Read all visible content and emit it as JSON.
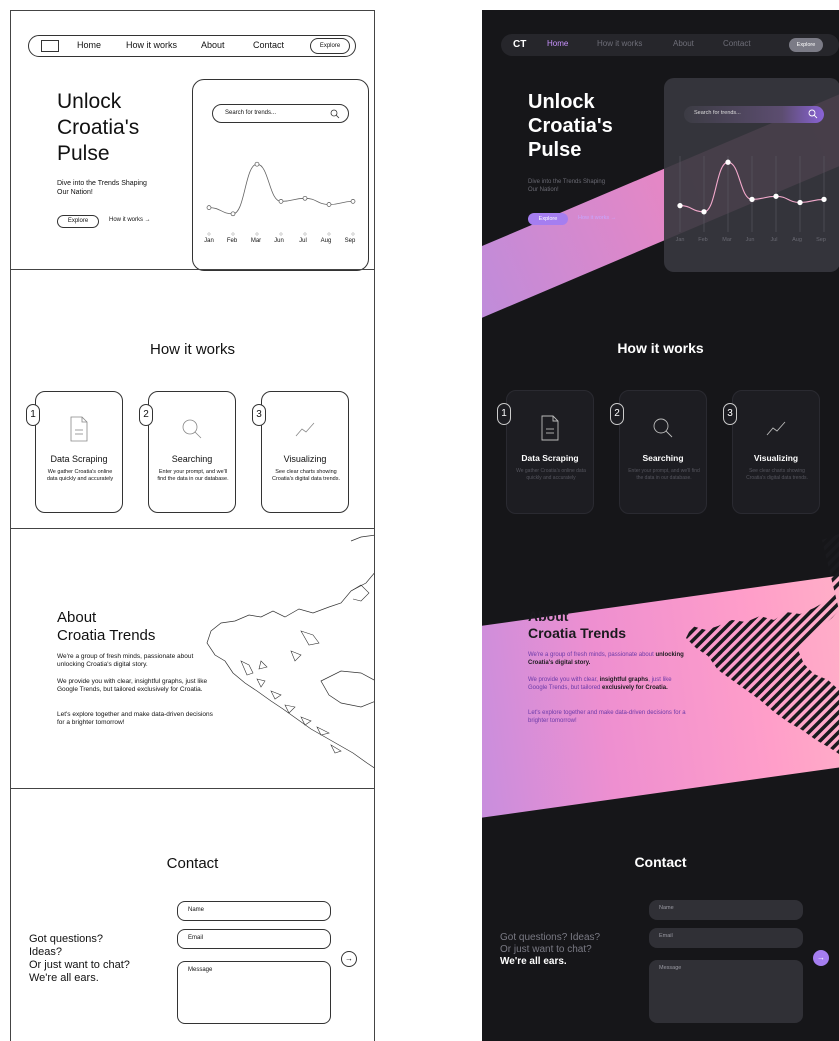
{
  "nav": {
    "logo": "CT",
    "links": [
      "Home",
      "How it works",
      "About",
      "Contact"
    ],
    "explore": "Explore"
  },
  "hero": {
    "title": "Unlock Croatia's Pulse",
    "subtitle": "Dive into the Trends Shaping Our Nation!",
    "cta_primary": "Explore",
    "cta_secondary": "How it works →"
  },
  "search": {
    "placeholder": "Search for trends..."
  },
  "chart_data": {
    "type": "line",
    "categories": [
      "Jan",
      "Feb",
      "Mar",
      "Jun",
      "Jul",
      "Aug",
      "Sep"
    ],
    "values": [
      2,
      1,
      9,
      3,
      3.5,
      2.5,
      3
    ]
  },
  "how": {
    "title": "How it works",
    "steps": [
      {
        "num": "1",
        "title": "Data Scraping",
        "desc": "We gather Croatia's online data quickly and accurately",
        "icon": "document-icon"
      },
      {
        "num": "2",
        "title": "Searching",
        "desc": "Enter your prompt, and we'll find the data in our database.",
        "icon": "search-icon"
      },
      {
        "num": "3",
        "title": "Visualizing",
        "desc": "See clear charts showing Croatia's digital data trends.",
        "icon": "trend-icon"
      }
    ]
  },
  "about": {
    "title_line1": "About",
    "title_line2": "Croatia Trends",
    "p1": "We're a group of fresh minds, passionate about unlocking Croatia's digital story.",
    "p1_plain": "We're a group of fresh minds, passionate about ",
    "p1_bold": "unlocking Croatia's digital story.",
    "p2": "We provide you with clear, insightful graphs, just like Google Trends, but tailored exclusively for Croatia.",
    "p2_a": "We provide you with clear, ",
    "p2_b": "insightful graphs",
    "p2_c": ", just like Google Trends, but tailored ",
    "p2_d": "exclusively for Croatia.",
    "p3": "Let's explore together and make data-driven decisions for a brighter tomorrow!"
  },
  "contact": {
    "title": "Contact",
    "q1": "Got questions?",
    "q2": "Ideas?",
    "q3": "Or just want to chat?",
    "q4": "We're all ears.",
    "dq1": "Got questions? Ideas?",
    "dq2": "Or just want to chat?",
    "name_ph": "Name",
    "email_ph": "Email",
    "message_ph": "Message",
    "send": "→"
  }
}
